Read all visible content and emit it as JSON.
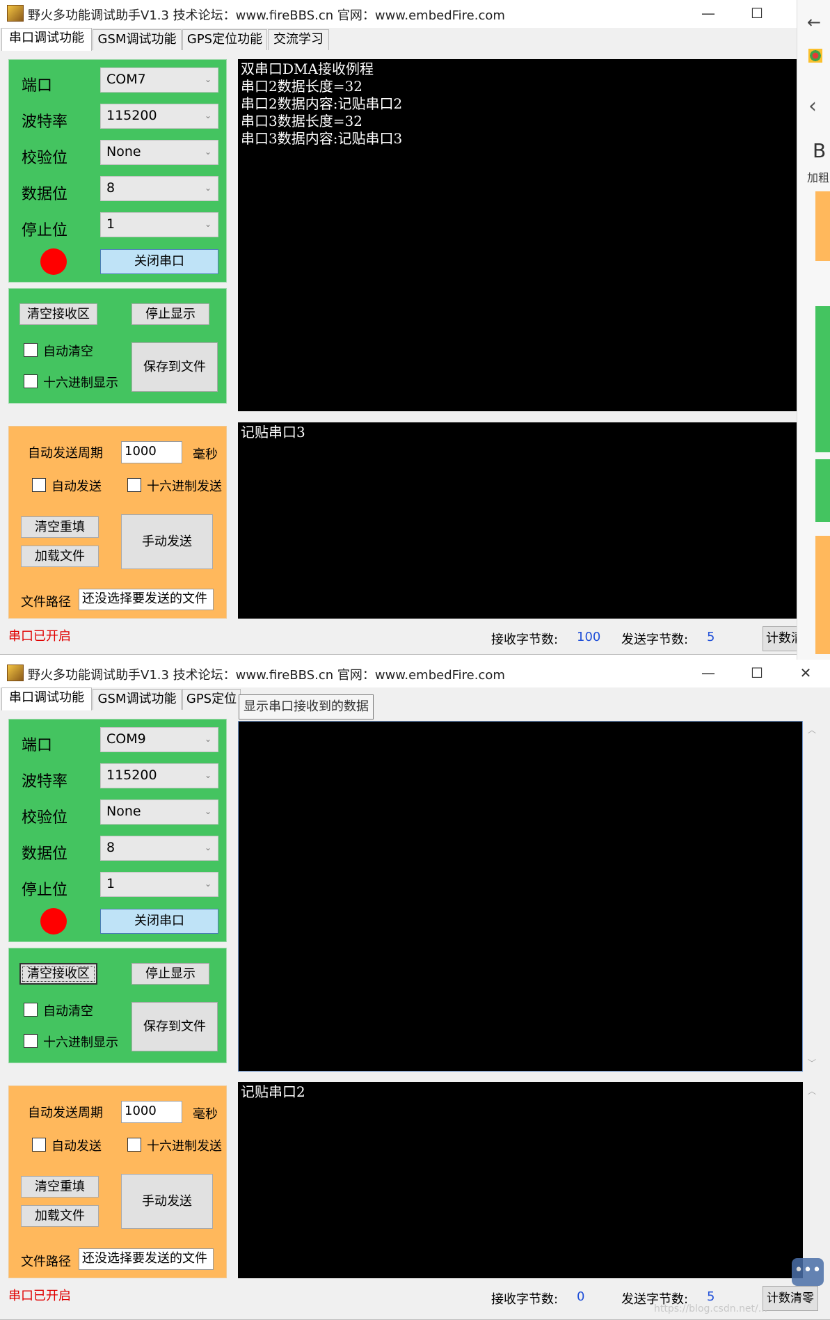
{
  "windows": [
    {
      "title": "野火多功能调试助手V1.3    技术论坛：www.fireBBS.cn    官网：www.embedFire.com",
      "tabs": [
        "串口调试功能",
        "GSM调试功能",
        "GPS定位功能",
        "交流学习"
      ],
      "serial": {
        "port_label": "端口",
        "port_value": "COM7",
        "baud_label": "波特率",
        "baud_value": "115200",
        "parity_label": "校验位",
        "parity_value": "None",
        "databits_label": "数据位",
        "databits_value": "8",
        "stopbits_label": "停止位",
        "stopbits_value": "1",
        "close_button": "关闭串口"
      },
      "receive_panel": {
        "clear_button": "清空接收区",
        "stop_button": "停止显示",
        "auto_clear": "自动清空",
        "hex_display": "十六进制显示",
        "save_button": "保存到文件"
      },
      "send_panel": {
        "period_label": "自动发送周期",
        "period_value": "1000",
        "period_unit": "毫秒",
        "auto_send": "自动发送",
        "hex_send": "十六进制发送",
        "clear_refill_button": "清空重填",
        "load_file_button": "加载文件",
        "manual_send_button": "手动发送",
        "file_path_label": "文件路径",
        "file_path_value": "还没选择要发送的文件"
      },
      "receive_text": "双串口DMA接收例程\n串口2数据长度=32\n串口2数据内容:记贴串口2\n串口3数据长度=32\n串口3数据内容:记贴串口3",
      "send_text": "记贴串口3",
      "status": "串口已开启",
      "rx_label": "接收字节数:",
      "rx_value": "100",
      "tx_label": "发送字节数:",
      "tx_value": "5",
      "count_clear_button": "计数清"
    },
    {
      "title": "野火多功能调试助手V1.3    技术论坛：www.fireBBS.cn    官网：www.embedFire.com",
      "tabs": [
        "串口调试功能",
        "GSM调试功能",
        "GPS定位"
      ],
      "tooltip": "显示串口接收到的数据",
      "serial": {
        "port_label": "端口",
        "port_value": "COM9",
        "baud_label": "波特率",
        "baud_value": "115200",
        "parity_label": "校验位",
        "parity_value": "None",
        "databits_label": "数据位",
        "databits_value": "8",
        "stopbits_label": "停止位",
        "stopbits_value": "1",
        "close_button": "关闭串口"
      },
      "receive_panel": {
        "clear_button": "清空接收区",
        "stop_button": "停止显示",
        "auto_clear": "自动清空",
        "hex_display": "十六进制显示",
        "save_button": "保存到文件"
      },
      "send_panel": {
        "period_label": "自动发送周期",
        "period_value": "1000",
        "period_unit": "毫秒",
        "auto_send": "自动发送",
        "hex_send": "十六进制发送",
        "clear_refill_button": "清空重填",
        "load_file_button": "加载文件",
        "manual_send_button": "手动发送",
        "file_path_label": "文件路径",
        "file_path_value": "还没选择要发送的文件"
      },
      "receive_text": "",
      "send_text": "记贴串口2",
      "status": "串口已开启",
      "rx_label": "接收字节数:",
      "rx_value": "0",
      "tx_label": "发送字节数:",
      "tx_value": "5",
      "count_clear_button": "计数清零"
    }
  ],
  "side_strip": {
    "heading_letter": "B",
    "heading_sub": "加粗"
  },
  "watermark": "https://blog.csdn.net/..."
}
